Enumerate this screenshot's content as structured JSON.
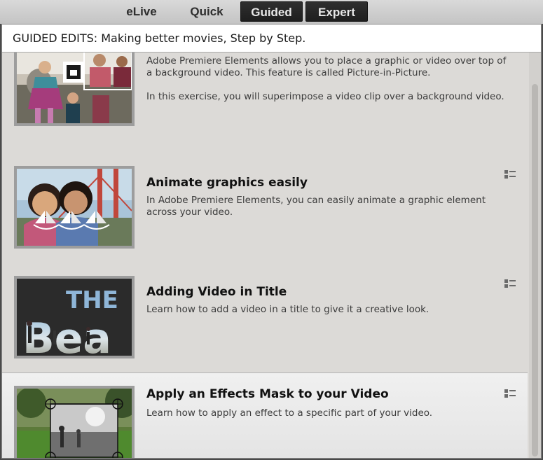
{
  "mode_tabs": [
    {
      "label": "eLive",
      "active": false
    },
    {
      "label": "Quick",
      "active": false
    },
    {
      "label": "Guided",
      "active": true
    },
    {
      "label": "Expert",
      "active": false
    }
  ],
  "panel": {
    "title": "GUIDED EDITS: Making better movies, Step by Step."
  },
  "items": [
    {
      "title": "",
      "desc_1": "Adobe Premiere Elements allows you to place a graphic or video over top of a background video. This feature is called Picture-in-Picture.",
      "desc_2": "In this exercise, you will superimpose a video clip over a background video.",
      "thumb": "picture-in-picture-thumbnail",
      "icon": "list-view-icon"
    },
    {
      "title": "Animate graphics easily",
      "desc_1": "In Adobe Premiere Elements, you can easily animate a graphic element across your video.",
      "thumb": "animate-graphics-thumbnail",
      "icon": "list-view-icon"
    },
    {
      "title": "Adding Video in Title",
      "desc_1": "Learn how to add a video in a title to give it a creative look.",
      "thumb": "video-in-title-thumbnail",
      "thumb_text_1": "THE",
      "thumb_text_2": "Bea",
      "icon": "list-view-icon"
    },
    {
      "title": "Apply an Effects Mask to your Video",
      "desc_1": "Learn how to apply an effect to a specific part of your video.",
      "thumb": "effects-mask-thumbnail",
      "icon": "list-view-icon",
      "selected": true
    }
  ],
  "colors": {
    "active_tab_bg": "#262626",
    "panel_bg": "#dcdad7",
    "selected_bg": "#ebebeb"
  }
}
